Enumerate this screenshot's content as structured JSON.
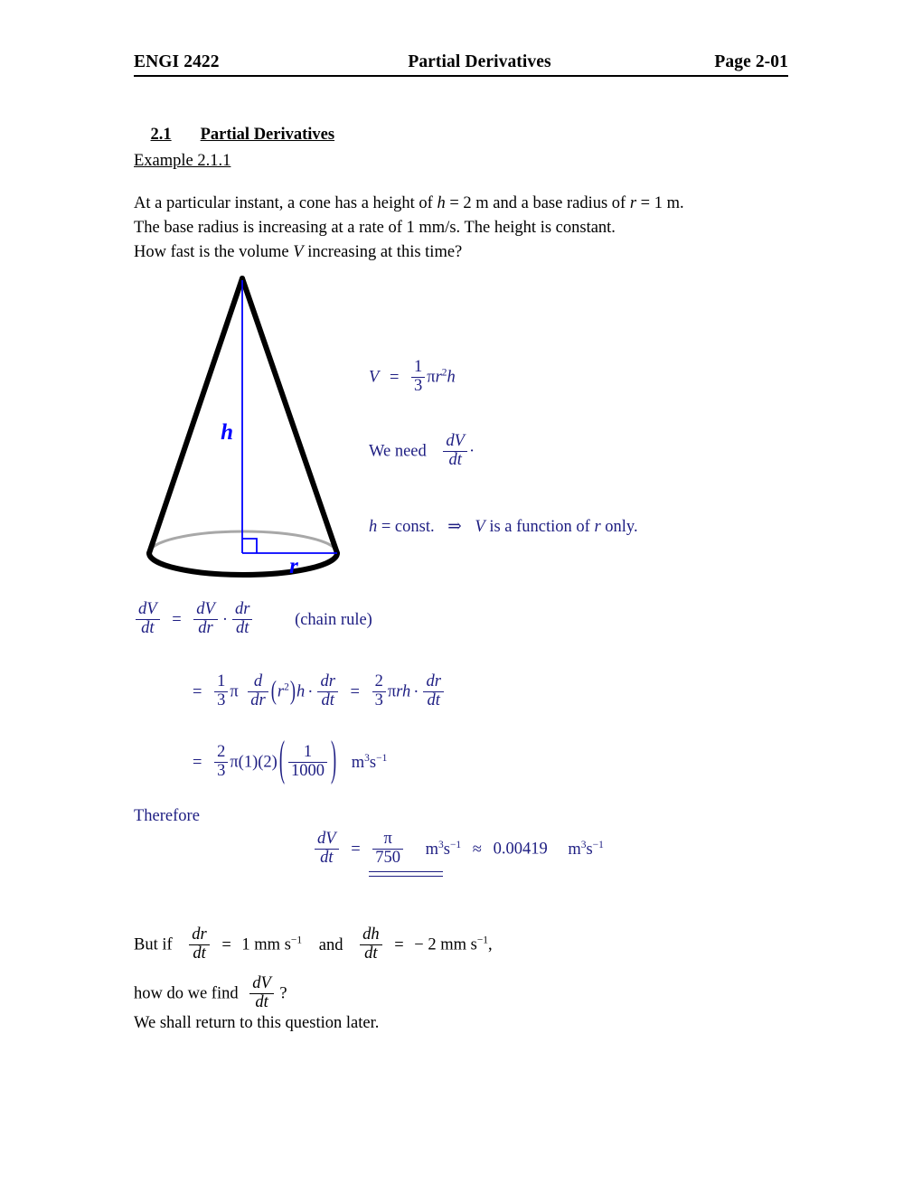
{
  "header": {
    "course": "ENGI 2422",
    "title": "Partial Derivatives",
    "page": "Page 2-01"
  },
  "section": {
    "number": "2.1",
    "title": "Partial Derivatives"
  },
  "example": {
    "label": "Example 2.1.1"
  },
  "problem": {
    "line1_a": "At a particular instant, a cone has a height of",
    "line1_h": "h",
    "line1_b": "= 2 m  and a base radius of",
    "line1_r": "r",
    "line1_c": "= 1 m.",
    "line2": "The base radius is increasing at a rate of  1 mm/s.   The height is constant.",
    "line3_a": "How fast is the volume",
    "line3_V": "V",
    "line3_b": "increasing at this time?"
  },
  "figure": {
    "name": "cone-diagram",
    "height_label": "h",
    "radius_label": "r",
    "outline_color": "#000000",
    "back_edge_color": "#a8a8a8",
    "annotation_color": "#0000ff"
  },
  "math": {
    "accent_color": "#1d1d82",
    "volume": {
      "V": "V",
      "eq": "=",
      "num": "1",
      "den": "3",
      "pi": "π",
      "r": "r",
      "exp": "2",
      "h": "h"
    },
    "we_need": {
      "text": "We need",
      "num": "dV",
      "den": "dt",
      "period": "·"
    },
    "const_line": {
      "h": "h",
      "eq_const": "= const.",
      "implies": "⇒",
      "V": "V",
      "tail_a": "is a function of",
      "r": "r",
      "tail_b": "only."
    },
    "chain": {
      "lhs_num": "dV",
      "lhs_den": "dt",
      "eq": "=",
      "t1_num": "dV",
      "t1_den": "dr",
      "dot": "·",
      "t2_num": "dr",
      "t2_den": "dt",
      "note": "(chain rule)"
    },
    "step2": {
      "eq": "=",
      "f1_num": "1",
      "f1_den": "3",
      "pi": "π",
      "d_num": "d",
      "d_den": "dr",
      "arg_open": "(",
      "arg_r": "r",
      "arg_exp": "2",
      "arg_close": ")",
      "h": "h",
      "dot": "·",
      "dr_num": "dr",
      "dr_den": "dt",
      "eq2": "=",
      "f2_num": "2",
      "f2_den": "3",
      "pi2": "π",
      "r2": "r",
      "h2": "h",
      "dot2": "·",
      "dr2_num": "dr",
      "dr2_den": "dt"
    },
    "step3": {
      "eq": "=",
      "f_num": "2",
      "f_den": "3",
      "pi": "π",
      "one": "(1)",
      "two": "(2)",
      "big_open": "(",
      "big_close": ")",
      "inner_num": "1",
      "inner_den": "1000",
      "units_m": "m",
      "units_m_exp": "3",
      "units_s": "s",
      "units_s_exp": "−1"
    },
    "therefore": "Therefore",
    "result": {
      "lhs_num": "dV",
      "lhs_den": "dt",
      "eq": "=",
      "pi": "π",
      "den": "750",
      "units1_m": "m",
      "units1_m_exp": "3",
      "units1_s": "s",
      "units1_s_exp": "−1",
      "approx": "≈",
      "value": "0.00419",
      "units2_m": "m",
      "units2_m_exp": "3",
      "units2_s": "s",
      "units2_s_exp": "−1"
    }
  },
  "closing": {
    "but_if": "But if",
    "dr_num": "dr",
    "dr_den": "dt",
    "eq1": "=",
    "val1": "1 mm s",
    "val1_exp": "−1",
    "and": "and",
    "dh_num": "dh",
    "dh_den": "dt",
    "eq2": "=",
    "val2": "− 2 mm s",
    "val2_exp": "−1",
    "comma": ",",
    "how_do_we_find": "how do we find",
    "dV_num": "dV",
    "dV_den": "dt",
    "question": "?",
    "return_later": "We shall return to this question later."
  }
}
